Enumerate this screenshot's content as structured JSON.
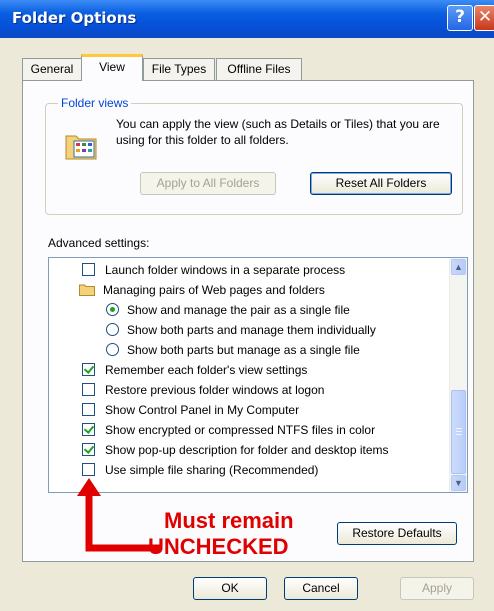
{
  "window": {
    "title": "Folder Options"
  },
  "tabs": [
    {
      "label": "General"
    },
    {
      "label": "View"
    },
    {
      "label": "File Types"
    },
    {
      "label": "Offline Files"
    }
  ],
  "folder_views": {
    "legend": "Folder views",
    "description": "You can apply the view (such as Details or Tiles) that you are using for this folder to all folders.",
    "apply_button": "Apply to All Folders",
    "reset_button": "Reset All Folders"
  },
  "advanced": {
    "label": "Advanced settings:",
    "items": [
      {
        "type": "checkbox",
        "checked": false,
        "label": "Launch folder windows in a separate process"
      },
      {
        "type": "folder",
        "label": "Managing pairs of Web pages and folders"
      },
      {
        "type": "radio",
        "checked": true,
        "label": "Show and manage the pair as a single file"
      },
      {
        "type": "radio",
        "checked": false,
        "label": "Show both parts and manage them individually"
      },
      {
        "type": "radio",
        "checked": false,
        "label": "Show both parts but manage as a single file"
      },
      {
        "type": "checkbox",
        "checked": true,
        "label": "Remember each folder's view settings"
      },
      {
        "type": "checkbox",
        "checked": false,
        "label": "Restore previous folder windows at logon"
      },
      {
        "type": "checkbox",
        "checked": false,
        "label": "Show Control Panel in My Computer"
      },
      {
        "type": "checkbox",
        "checked": true,
        "label": "Show encrypted or compressed NTFS files in color"
      },
      {
        "type": "checkbox",
        "checked": true,
        "label": "Show pop-up description for folder and desktop items"
      },
      {
        "type": "checkbox",
        "checked": false,
        "label": "Use simple file sharing (Recommended)"
      }
    ]
  },
  "restore_defaults_button": "Restore Defaults",
  "annotation": {
    "line1": "Must remain",
    "line2": "UNCHECKED"
  },
  "footer": {
    "ok": "OK",
    "cancel": "Cancel",
    "apply": "Apply"
  },
  "colors": {
    "annotation": "#e00000",
    "titlebar": "#0a5ee0",
    "dialog": "#ece9d8"
  }
}
